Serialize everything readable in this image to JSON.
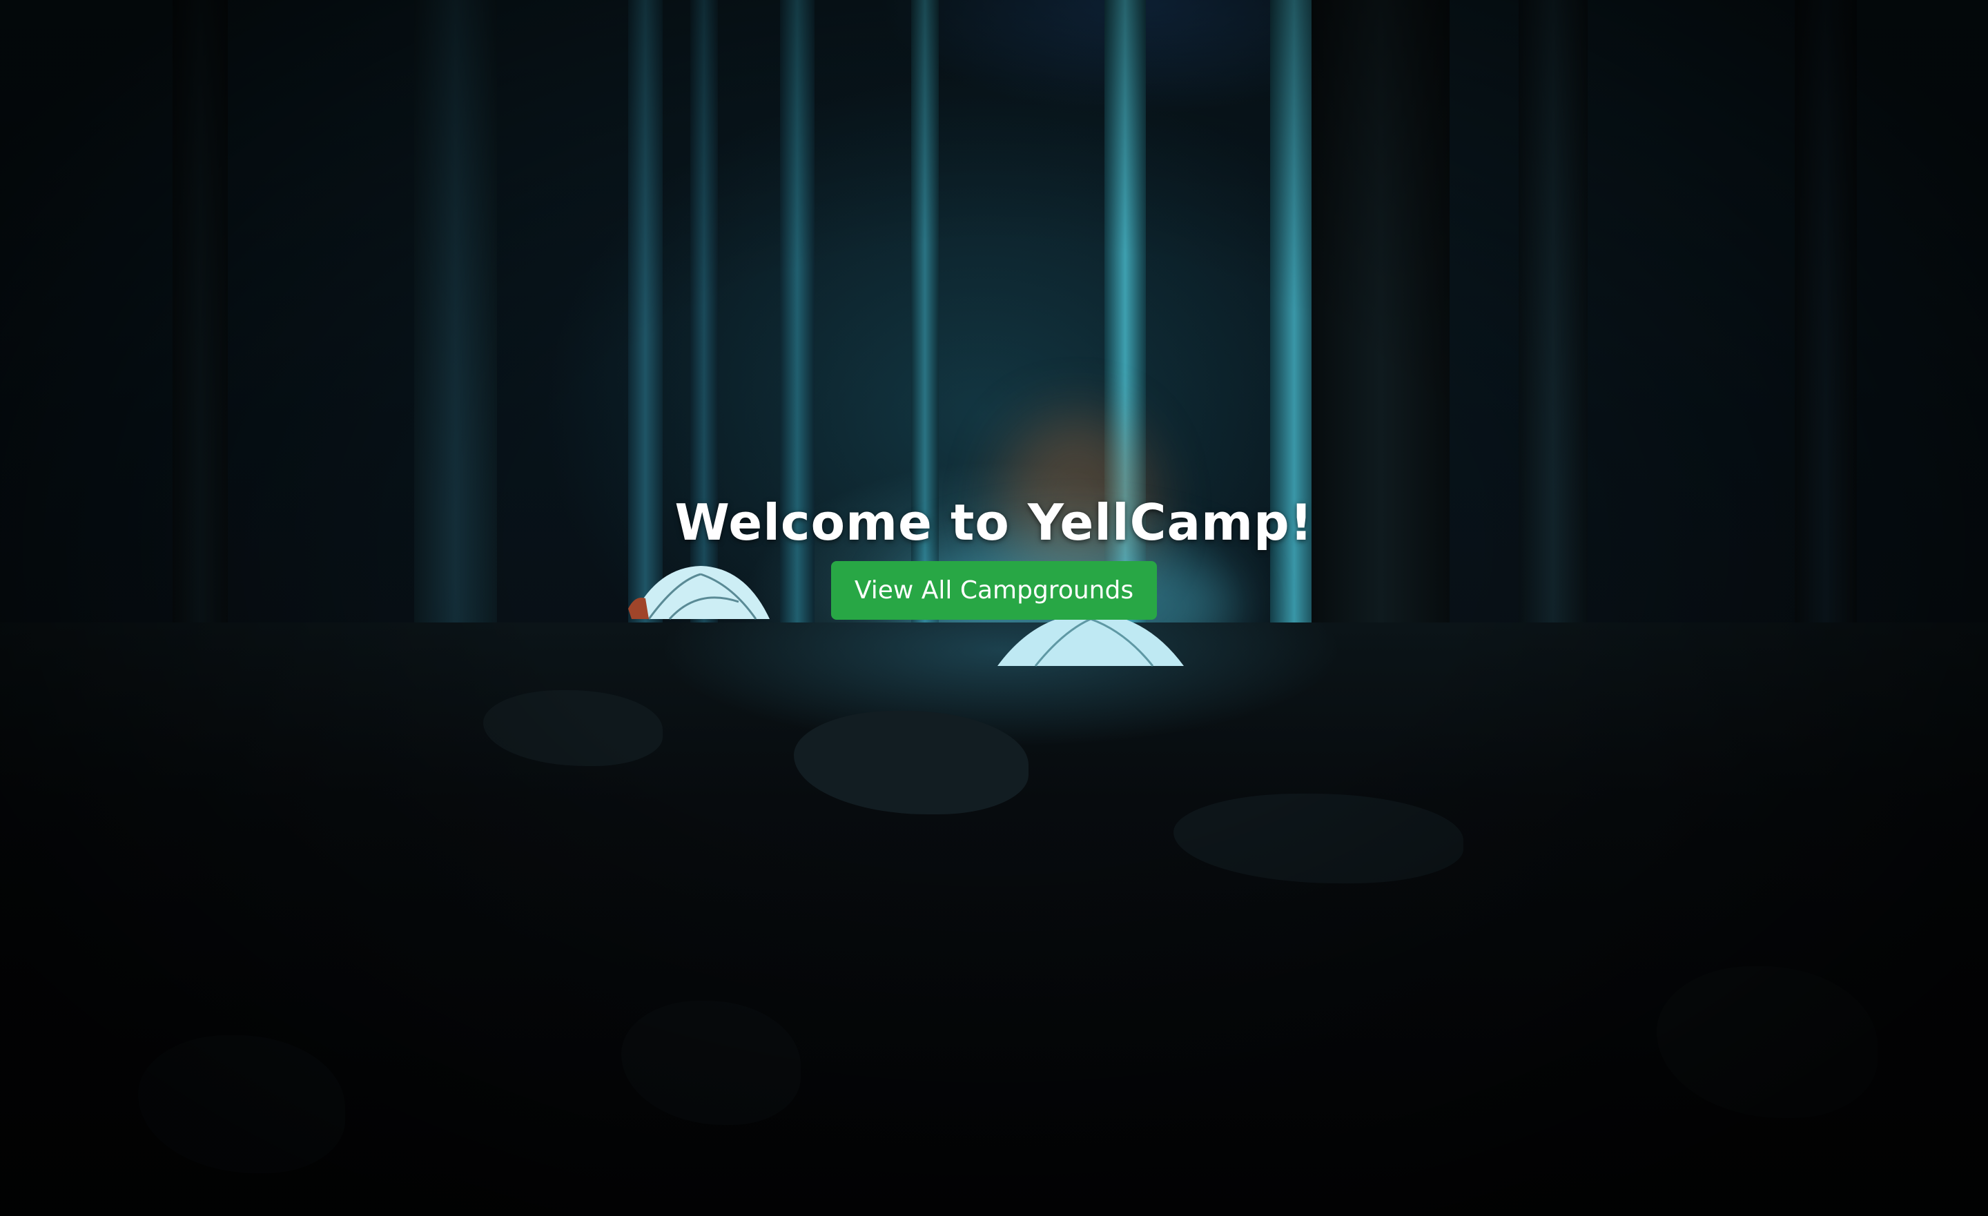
{
  "hero": {
    "title": "Welcome to YellCamp!",
    "button_label": "View All Campgrounds",
    "button_color": "#28a745",
    "background": "night-forest-campsite-photo"
  }
}
